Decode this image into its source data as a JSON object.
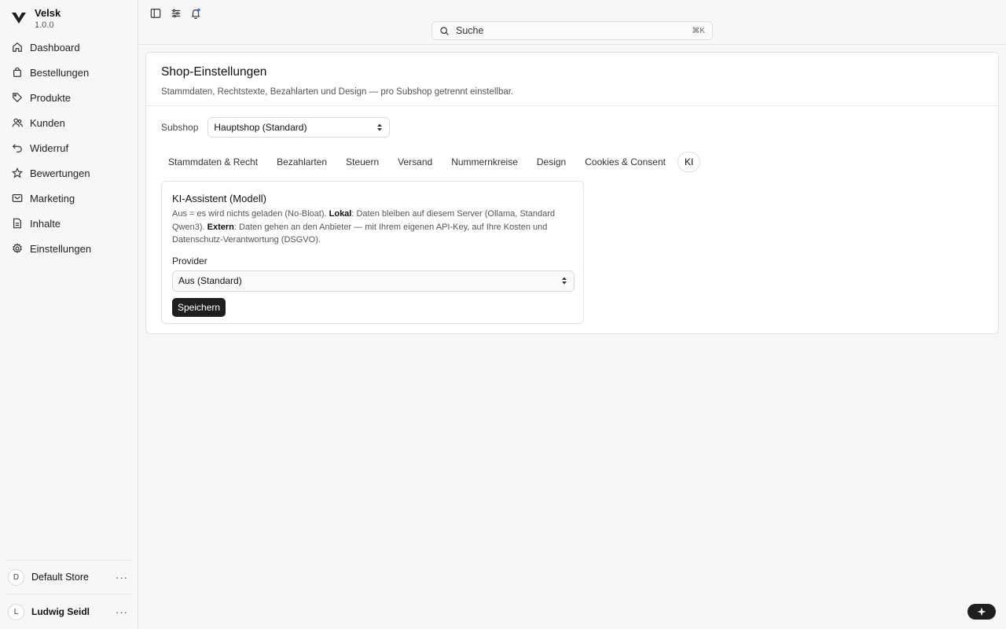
{
  "brand": {
    "name": "Velsk",
    "version": "1.0.0"
  },
  "sidebar": {
    "items": [
      {
        "label": "Dashboard",
        "icon": "home-icon"
      },
      {
        "label": "Bestellungen",
        "icon": "shopping-bag-icon"
      },
      {
        "label": "Produkte",
        "icon": "tag-icon"
      },
      {
        "label": "Kunden",
        "icon": "users-icon"
      },
      {
        "label": "Widerruf",
        "icon": "undo-icon"
      },
      {
        "label": "Bewertungen",
        "icon": "star-icon"
      },
      {
        "label": "Marketing",
        "icon": "ticket-icon"
      },
      {
        "label": "Inhalte",
        "icon": "file-icon"
      },
      {
        "label": "Einstellungen",
        "icon": "gear-icon"
      }
    ],
    "store": {
      "initial": "D",
      "name": "Default Store",
      "more": "···"
    },
    "user": {
      "initial": "L",
      "name": "Ludwig Seidl",
      "more": "···"
    }
  },
  "topbar": {
    "search_placeholder": "Suche",
    "search_shortcut": "⌘K"
  },
  "page": {
    "title": "Shop-Einstellungen",
    "subtitle": "Stammdaten, Rechtstexte, Bezahlarten und Design — pro Subshop getrennt einstellbar.",
    "subshop_label": "Subshop",
    "subshop_value": "Hauptshop (Standard)",
    "tabs": [
      {
        "label": "Stammdaten & Recht"
      },
      {
        "label": "Bezahlarten"
      },
      {
        "label": "Steuern"
      },
      {
        "label": "Versand"
      },
      {
        "label": "Nummernkreise"
      },
      {
        "label": "Design"
      },
      {
        "label": "Cookies & Consent"
      },
      {
        "label": "KI",
        "active": true
      }
    ]
  },
  "panel": {
    "title": "KI-Assistent (Modell)",
    "desc_1": "Aus = es wird nichts geladen (No-Bloat). ",
    "desc_bold_1": "Lokal",
    "desc_2": ": Daten bleiben auf diesem Server (Ollama, Standard Qwen3). ",
    "desc_bold_2": "Extern",
    "desc_3": ": Daten gehen an den Anbieter — mit Ihrem eigenen API-Key, auf Ihre Kosten und Datenschutz-Verantwortung (DSGVO).",
    "provider_label": "Provider",
    "provider_value": "Aus (Standard)",
    "save_label": "Speichern"
  },
  "colors": {
    "accent": "#1f1f1f",
    "notification_dot": "#2f6fe4"
  }
}
